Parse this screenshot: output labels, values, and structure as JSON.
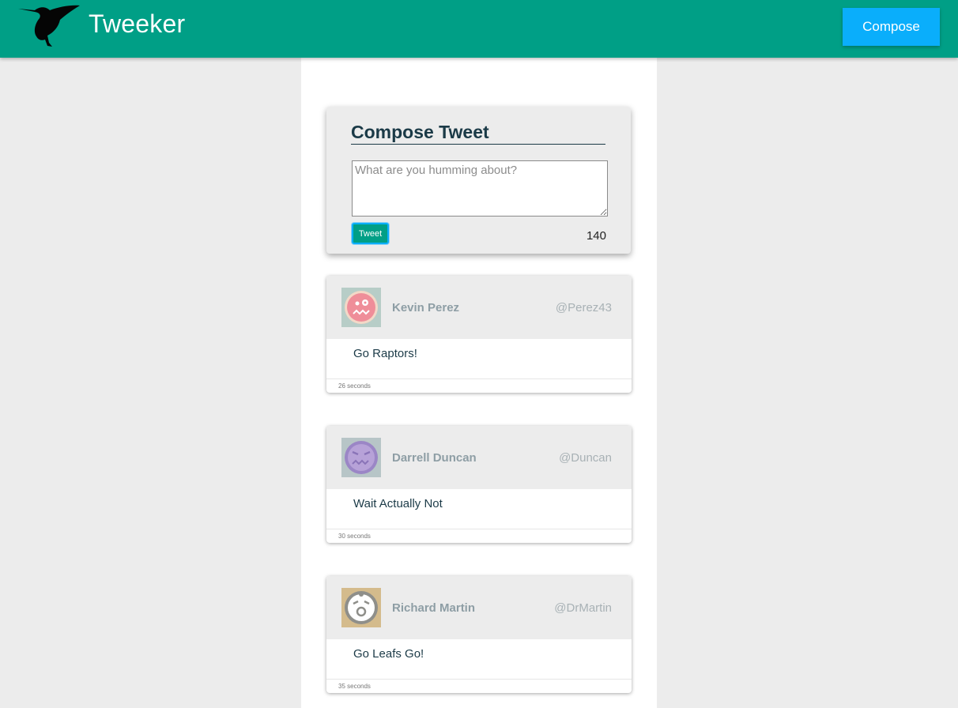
{
  "header": {
    "brand": "Tweeker",
    "logo_icon": "hummingbird-icon",
    "compose_label": "Compose",
    "bar_color": "#009f86",
    "compose_color": "#0aaefb"
  },
  "composer": {
    "title": "Compose Tweet",
    "placeholder": "What are you humming about?",
    "value": "",
    "submit_label": "Tweet",
    "counter": "140"
  },
  "tweets": [
    {
      "name": "Kevin Perez",
      "handle": "@Perez43",
      "text": "Go Raptors!",
      "time": "26 seconds",
      "avatar_icon": "pink-face-avatar-icon",
      "avatar_color": "#ef8e99"
    },
    {
      "name": "Darrell Duncan",
      "handle": "@Duncan",
      "text": "Wait Actually Not",
      "time": "30 seconds",
      "avatar_icon": "purple-face-avatar-icon",
      "avatar_color": "#9b86c6"
    },
    {
      "name": "Richard Martin",
      "handle": "@DrMartin",
      "text": "Go Leafs Go!",
      "time": "35 seconds",
      "avatar_icon": "gray-face-avatar-icon",
      "avatar_color": "#8f8f8a"
    }
  ]
}
